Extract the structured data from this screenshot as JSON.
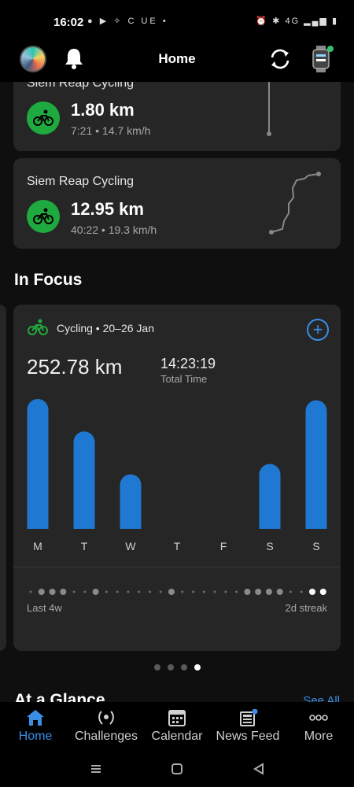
{
  "status_bar": {
    "time": "16:02",
    "apps_text": "● ▶ ✧ C UE •",
    "right_text": "⏰ ✱ 4G ▂▄▆ ▮"
  },
  "header": {
    "title": "Home"
  },
  "activities": [
    {
      "title": "Siem Reap Cycling",
      "distance": "1.80 km",
      "detail": "7:21 • 14.7 km/h"
    },
    {
      "title": "Siem Reap Cycling",
      "distance": "12.95 km",
      "detail": "40:22 • 19.3 km/h"
    }
  ],
  "in_focus": {
    "section_title": "In Focus",
    "heading": "Cycling • 20–26 Jan",
    "total": "252.78 km",
    "time_value": "14:23:19",
    "time_label": "Total Time",
    "last_label": "Last 4w",
    "streak_label": "2d streak",
    "chart_data": {
      "type": "bar",
      "categories": [
        "M",
        "T",
        "W",
        "T",
        "F",
        "S",
        "S"
      ],
      "values": [
        1.0,
        0.75,
        0.42,
        0,
        0,
        0.5,
        0.99
      ],
      "note_units": "relative daily distance",
      "bar_color": "#1f78d1"
    },
    "streak_dots": [
      0,
      1,
      1,
      1,
      0,
      0,
      1,
      0,
      0,
      0,
      0,
      0,
      0,
      1,
      0,
      0,
      0,
      0,
      0,
      0,
      1,
      1,
      1,
      1,
      0,
      0,
      2,
      2
    ]
  },
  "pager": {
    "count": 4,
    "active": 3
  },
  "glance": {
    "title": "At a Glance",
    "see_all": "See All"
  },
  "nav": [
    {
      "label": "Home",
      "icon": "home-icon"
    },
    {
      "label": "Challenges",
      "icon": "laurel-icon"
    },
    {
      "label": "Calendar",
      "icon": "calendar-icon"
    },
    {
      "label": "News Feed",
      "icon": "news-icon"
    },
    {
      "label": "More",
      "icon": "more-icon"
    }
  ],
  "colors": {
    "accent": "#3a8ee6",
    "activity_green": "#1faa3f",
    "card": "#262626"
  }
}
